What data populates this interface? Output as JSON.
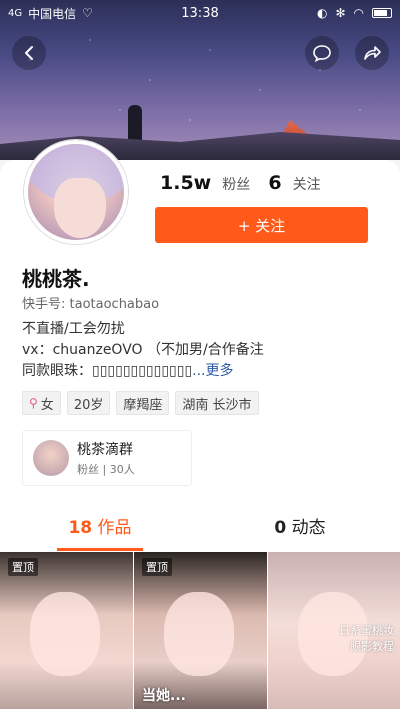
{
  "status_bar": {
    "carrier": "中国电信",
    "signal": "4G",
    "time": "13:38"
  },
  "header": {
    "back_icon": "back-arrow-icon",
    "chat_icon": "chat-bubble-icon",
    "share_icon": "share-arrow-icon"
  },
  "profile": {
    "stats": [
      {
        "value": "1.5w",
        "label": "粉丝"
      },
      {
        "value": "6",
        "label": "关注"
      }
    ],
    "follow_label": "+ 关注",
    "name": "桃桃茶.",
    "kuaishou_id": "快手号: taotaochabao",
    "bio_lines": [
      "不直播/工会勿扰",
      "vx：chuanzeOVO （不加男/合作备注",
      "同款眼珠：▯▯▯▯▯▯▯▯▯▯▯▯▯"
    ],
    "bio_more": "...更多",
    "tags": [
      {
        "label": "女"
      },
      {
        "label": "20岁"
      },
      {
        "label": "摩羯座"
      },
      {
        "label": "湖南 长沙市"
      }
    ]
  },
  "group": {
    "title": "桃茶滴群",
    "subtitle": "粉丝 | 30人"
  },
  "tabs": [
    {
      "count": "18",
      "label": "作品",
      "active": true
    },
    {
      "count": "0",
      "label": "动态",
      "active": false
    }
  ],
  "thumbnails": [
    {
      "pin": "置顶",
      "caption": "",
      "subtitle": ""
    },
    {
      "pin": "置顶",
      "caption": "",
      "subtitle": "当她..."
    },
    {
      "pin": "",
      "caption": "日系蜜桃妆\n眼影教程",
      "subtitle": ""
    }
  ],
  "colors": {
    "accent": "#ff5a1a",
    "link": "#2a5aa8"
  }
}
